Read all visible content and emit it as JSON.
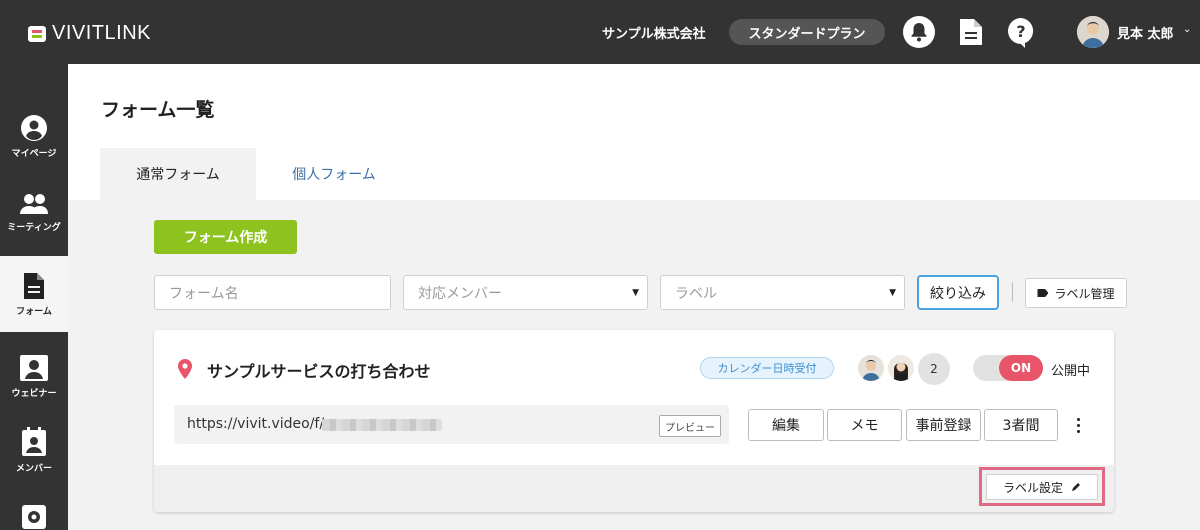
{
  "app": {
    "logo_text": "VIVITLINK",
    "company": "サンプル株式会社",
    "plan": "スタンダードプラン",
    "user_name": "見本 太郎",
    "icons": [
      "bell-icon",
      "document-icon",
      "help-icon",
      "chevron-down-icon"
    ]
  },
  "sidebar": {
    "items": [
      {
        "label": "マイページ",
        "icon": "user-circle-icon",
        "active": false
      },
      {
        "label": "ミーティング",
        "icon": "people-icon",
        "active": false
      },
      {
        "label": "フォーム",
        "icon": "document-icon",
        "active": true
      },
      {
        "label": "ウェビナー",
        "icon": "presenter-icon",
        "active": false
      },
      {
        "label": "メンバー",
        "icon": "id-badge-icon",
        "active": false
      },
      {
        "label": "",
        "icon": "gear-icon",
        "active": false
      }
    ]
  },
  "page": {
    "title": "フォーム一覧",
    "tabs": [
      {
        "label": "通常フォーム",
        "active": true
      },
      {
        "label": "個人フォーム",
        "active": false
      }
    ]
  },
  "controls": {
    "create_button": "フォーム作成",
    "form_name_placeholder": "フォーム名",
    "member_select": "対応メンバー",
    "label_select": "ラベル",
    "filter_button": "絞り込み",
    "label_manage_button": "ラベル管理"
  },
  "form_card": {
    "title": "サンプルサービスの打ち合わせ",
    "badge": "カレンダー日時受付",
    "member_count": "2",
    "toggle_label": "ON",
    "toggle_on": true,
    "status": "公開中",
    "url": "https://vivit.video/f/",
    "preview_button": "プレビュー",
    "actions": [
      "編集",
      "メモ",
      "事前登録",
      "3者間"
    ],
    "label_setting_button": "ラベル設定"
  },
  "colors": {
    "topbar": "#333333",
    "create_green": "#8dc21f",
    "toggle_red": "#e8546a",
    "highlight_outline": "#e06a84",
    "link_blue": "#3a6fa8",
    "filter_border": "#4aa3df"
  }
}
